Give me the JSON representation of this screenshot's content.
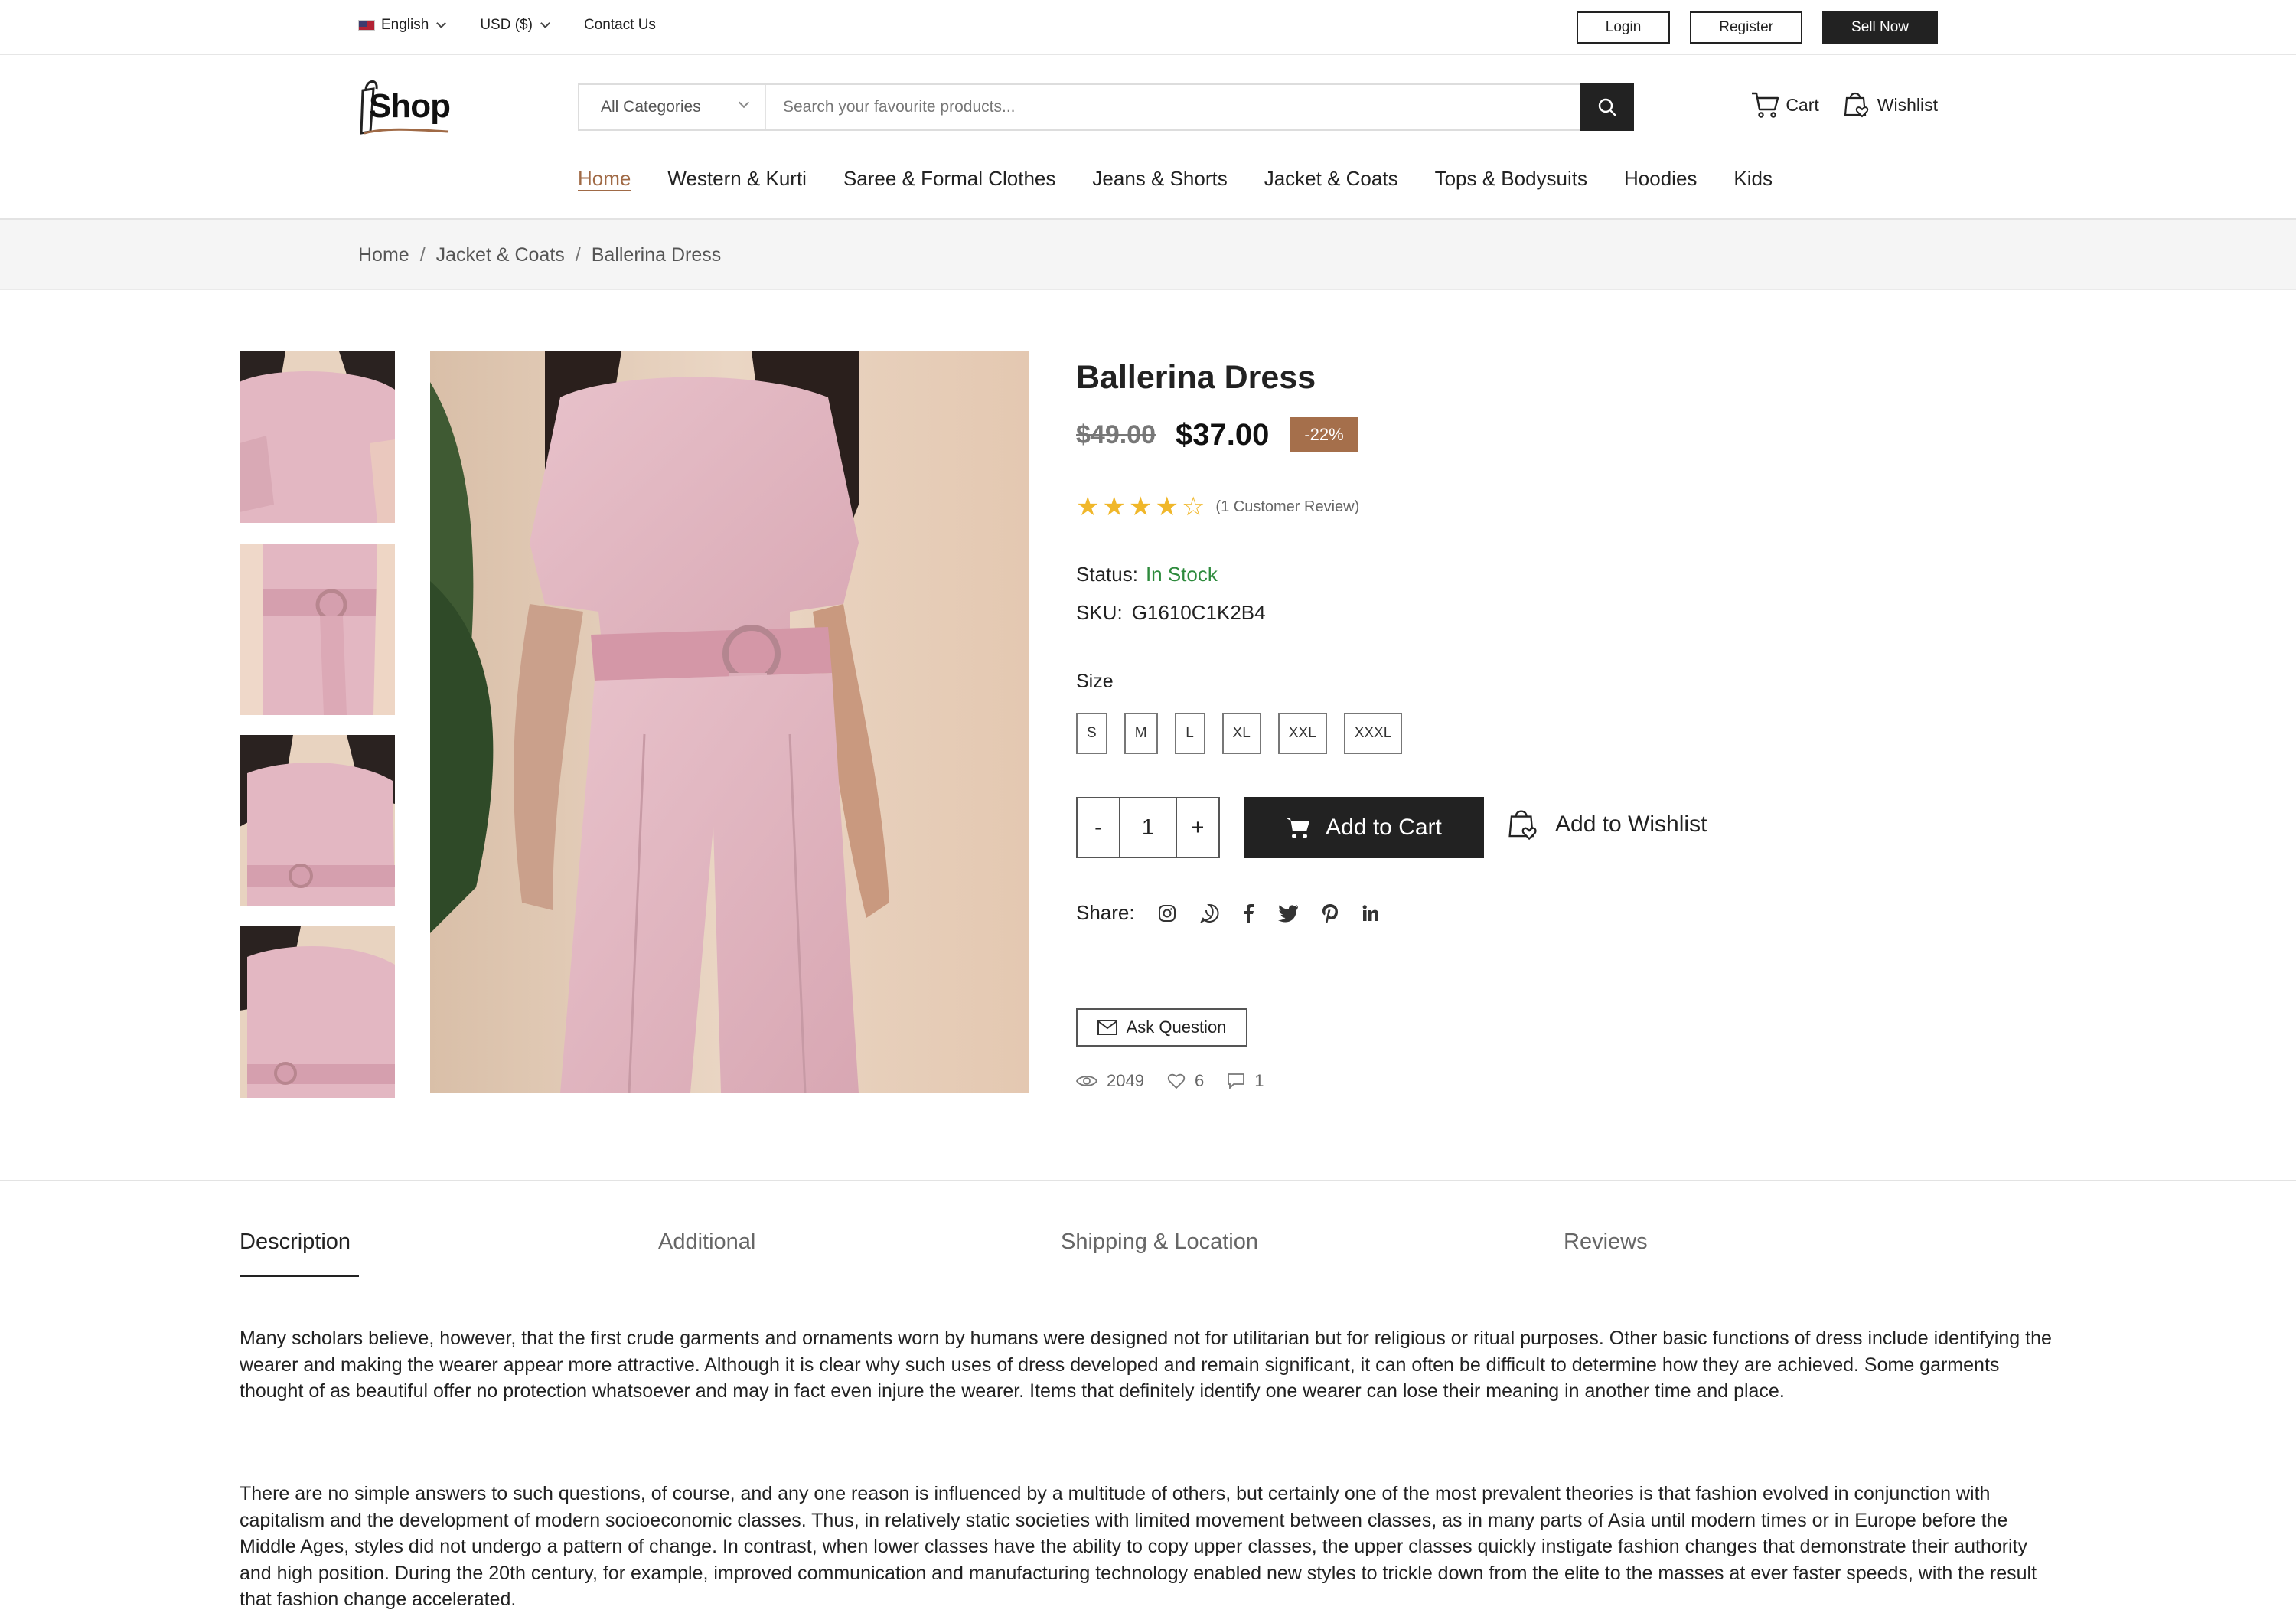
{
  "topbar": {
    "language": "English",
    "currency": "USD ($)",
    "contact": "Contact Us",
    "login": "Login",
    "register": "Register",
    "sell": "Sell Now"
  },
  "header": {
    "logo_text": "Shop",
    "category": "All Categories",
    "search_placeholder": "Search your favourite products...",
    "cart": "Cart",
    "wishlist": "Wishlist"
  },
  "nav": {
    "items": [
      "Home",
      "Western & Kurti",
      "Saree & Formal Clothes",
      "Jeans & Shorts",
      "Jacket & Coats",
      "Tops & Bodysuits",
      "Hoodies",
      "Kids"
    ],
    "active": "Home"
  },
  "breadcrumb": [
    "Home",
    "Jacket & Coats",
    "Ballerina Dress"
  ],
  "product": {
    "title": "Ballerina Dress",
    "old_price": "$49.00",
    "price": "$37.00",
    "discount": "-22%",
    "rating": 4,
    "rating_max": 5,
    "reviews": "(1 Customer Review)",
    "status_label": "Status:",
    "status": "In Stock",
    "sku_label": "SKU:",
    "sku": "G1610C1K2B4",
    "size_label": "Size",
    "sizes": [
      "S",
      "M",
      "L",
      "XL",
      "XXL",
      "XXXL"
    ],
    "qty_minus": "-",
    "quantity": "1",
    "qty_plus": "+",
    "add_to_cart": "Add to Cart",
    "add_to_wishlist": "Add to Wishlist",
    "share_label": "Share:",
    "share_icons": [
      "instagram-icon",
      "whatsapp-icon",
      "facebook-icon",
      "twitter-icon",
      "pinterest-icon",
      "linkedin-icon"
    ],
    "ask_question": "Ask Question",
    "views": "2049",
    "likes": "6",
    "comments": "1"
  },
  "tabs": [
    "Description",
    "Additional",
    "Shipping & Location",
    "Reviews"
  ],
  "description": [
    "Many scholars believe, however, that the first crude garments and ornaments worn by humans were designed not for utilitarian but for religious or ritual purposes. Other basic functions of dress include identifying the wearer and making the wearer appear more attractive. Although it is clear why such uses of dress developed and remain significant, it can often be difficult to determine how they are achieved. Some garments thought of as beautiful offer no protection whatsoever and may in fact even injure the wearer. Items that definitely identify one wearer can lose their meaning in another time and place.",
    "There are no simple answers to such questions, of course, and any one reason is influenced by a multitude of others, but certainly one of the most prevalent theories is that fashion evolved in conjunction with capitalism and the development of modern socioeconomic classes. Thus, in relatively static societies with limited movement between classes, as in many parts of Asia until modern times or in Europe before the Middle Ages, styles did not undergo a pattern of change. In contrast, when lower classes have the ability to copy upper classes, the upper classes quickly instigate fashion changes that demonstrate their authority and high position. During the 20th century, for example, improved communication and manufacturing technology enabled new styles to trickle down from the elite to the masses at ever faster speeds, with the result that  fashion change accelerated."
  ],
  "colors": {
    "accent": "#a06a46",
    "badge": "#a56f4b",
    "in_stock": "#2d8a3c",
    "star": "#f0b72a",
    "dark": "#222222"
  }
}
